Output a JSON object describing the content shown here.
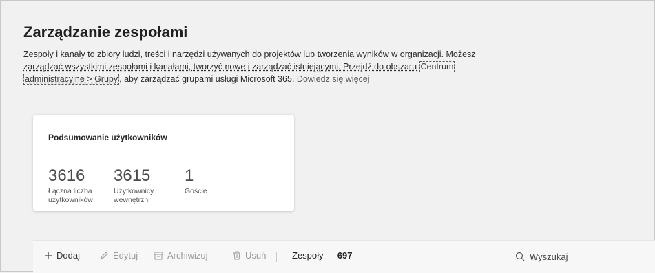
{
  "page": {
    "title": "Zarządzanie zespołami",
    "description_line1": "Zespoły i kanały to zbiory ludzi, treści i narzędzi używanych do projektów lub tworzenia wyników w organizacji. Możesz",
    "description_line2_a": "zarządzać wszystkimi zespołami i kanałami, tworzyć nowe i zarządzać istniejącymi. Przejdź do obszaru",
    "link_part1": "Centrum",
    "link_part2": "administracyjne > Grupy",
    "description_line3_b": ", aby zarządzać grupami usługi Microsoft 365.",
    "learn_more": "Dowiedz się więcej"
  },
  "summary": {
    "title": "Podsumowanie użytkowników",
    "stats": [
      {
        "value": "3616",
        "label_line1": "Łączna liczba",
        "label_line2": "użytkowników"
      },
      {
        "value": "3615",
        "label_line1": "Użytkownicy",
        "label_line2": "wewnętrzni"
      },
      {
        "value": "1",
        "label_line1": "Goście",
        "label_line2": ""
      }
    ]
  },
  "toolbar": {
    "add_label": "Dodaj",
    "edit_label": "Edytuj",
    "archive_label": "Archiwizuj",
    "delete_label": "Usuń",
    "teams_label": "Zespoły —",
    "teams_count": "697",
    "search_placeholder": "Wyszukaj"
  },
  "icons": {
    "add": "plus-icon",
    "edit": "pencil-icon",
    "archive": "archive-icon",
    "delete": "trash-icon",
    "search": "search-icon"
  }
}
